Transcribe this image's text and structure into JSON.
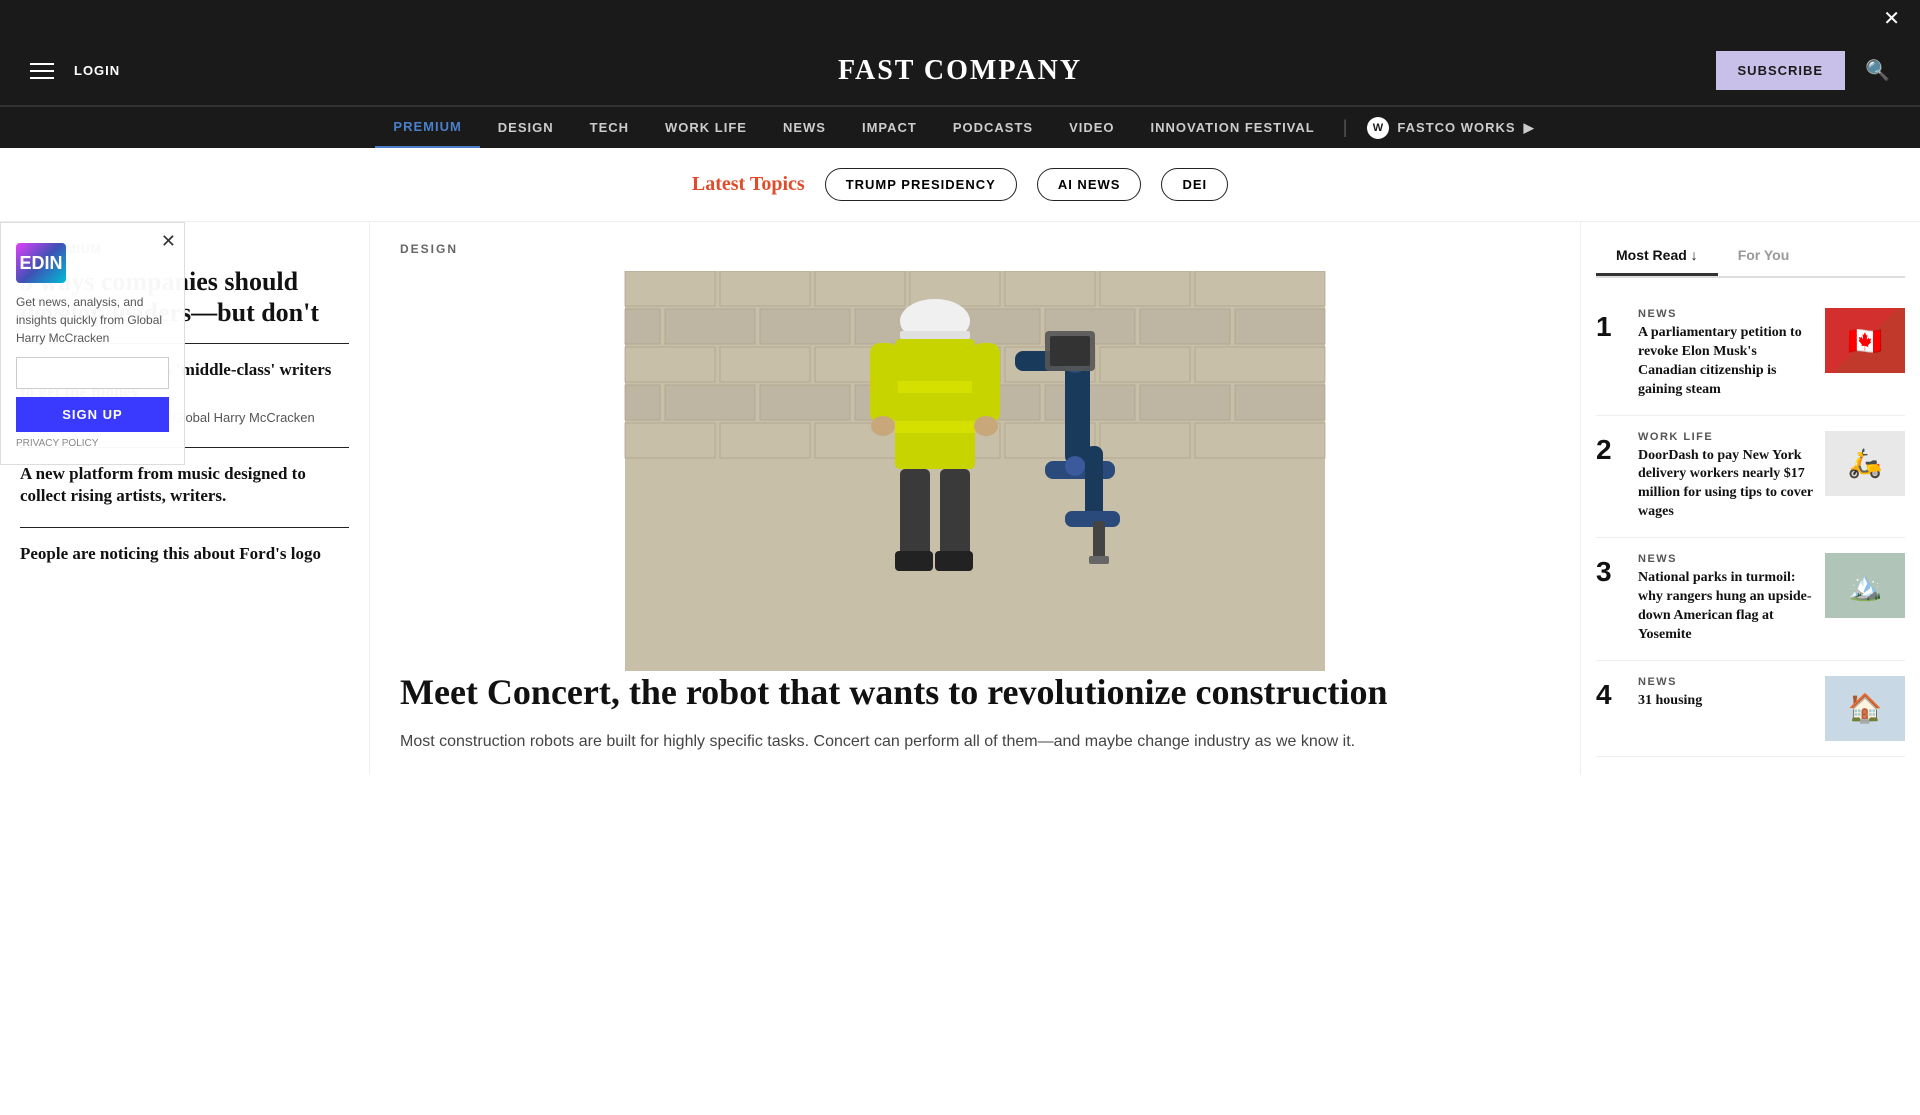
{
  "topbar": {
    "close_label": "✕"
  },
  "header": {
    "login_label": "LOGIN",
    "logo": "FAST COMPANY",
    "subscribe_label": "SUBSCRIBE"
  },
  "nav": {
    "items": [
      {
        "label": "PREMIUM",
        "active": true
      },
      {
        "label": "DESIGN",
        "active": false
      },
      {
        "label": "TECH",
        "active": false
      },
      {
        "label": "WORK LIFE",
        "active": false
      },
      {
        "label": "NEWS",
        "active": false
      },
      {
        "label": "IMPACT",
        "active": false
      },
      {
        "label": "PODCASTS",
        "active": false
      },
      {
        "label": "VIDEO",
        "active": false
      },
      {
        "label": "INNOVATION FESTIVAL",
        "active": false
      }
    ],
    "fastco_works": "FASTCO WORKS",
    "fastco_badge": "W"
  },
  "topics": {
    "label": "Latest Topics",
    "pills": [
      "TRUMP PRESIDENCY",
      "AI NEWS",
      "DEI"
    ]
  },
  "left_sidebar": {
    "premium_label": "PREMIUM",
    "main_title": "3 ways companies should develop leaders—but don't",
    "sections": [
      {
        "label": "",
        "title": "This publisher wants 'middle-class' writers to get the money",
        "desc": "analysis, and quickly from Global Harry McCracken"
      },
      {
        "label": "",
        "title": "A new platform from music designed to collect rising artists, writers.",
        "desc": ""
      },
      {
        "label": "",
        "title": "People are noticing this about Ford's logo",
        "desc": ""
      }
    ]
  },
  "newsletter": {
    "logo_text": "IN",
    "logo_prefix": "ED",
    "description": "Get news, analysis, and insights quickly from Global Harry McCracken",
    "input_placeholder": "",
    "submit_label": "SIGN UP",
    "policy_label": "PRIVACY POLICY"
  },
  "article": {
    "section_label": "DESIGN",
    "title": "Meet Concert, the robot that wants to revolutionize construction",
    "description": "Most construction robots are built for highly specific tasks. Concert can perform all of them—and maybe change industry as we know it."
  },
  "right_sidebar": {
    "tabs": [
      {
        "label": "Most Read ↓",
        "active": true
      },
      {
        "label": "For You",
        "active": false
      }
    ],
    "items": [
      {
        "number": "1",
        "category": "NEWS",
        "title": "A parliamentary petition to revoke Elon Musk's Canadian citizenship is gaining steam",
        "thumb_class": "thumb-1"
      },
      {
        "number": "2",
        "category": "WORK LIFE",
        "title": "DoorDash to pay New York delivery workers nearly $17 million for using tips to cover wages",
        "thumb_class": "thumb-2"
      },
      {
        "number": "3",
        "category": "NEWS",
        "title": "National parks in turmoil: why rangers hung an upside-down American flag at Yosemite",
        "thumb_class": "thumb-3"
      },
      {
        "number": "4",
        "category": "NEWS",
        "title": "31 housing",
        "thumb_class": "thumb-4"
      }
    ]
  }
}
